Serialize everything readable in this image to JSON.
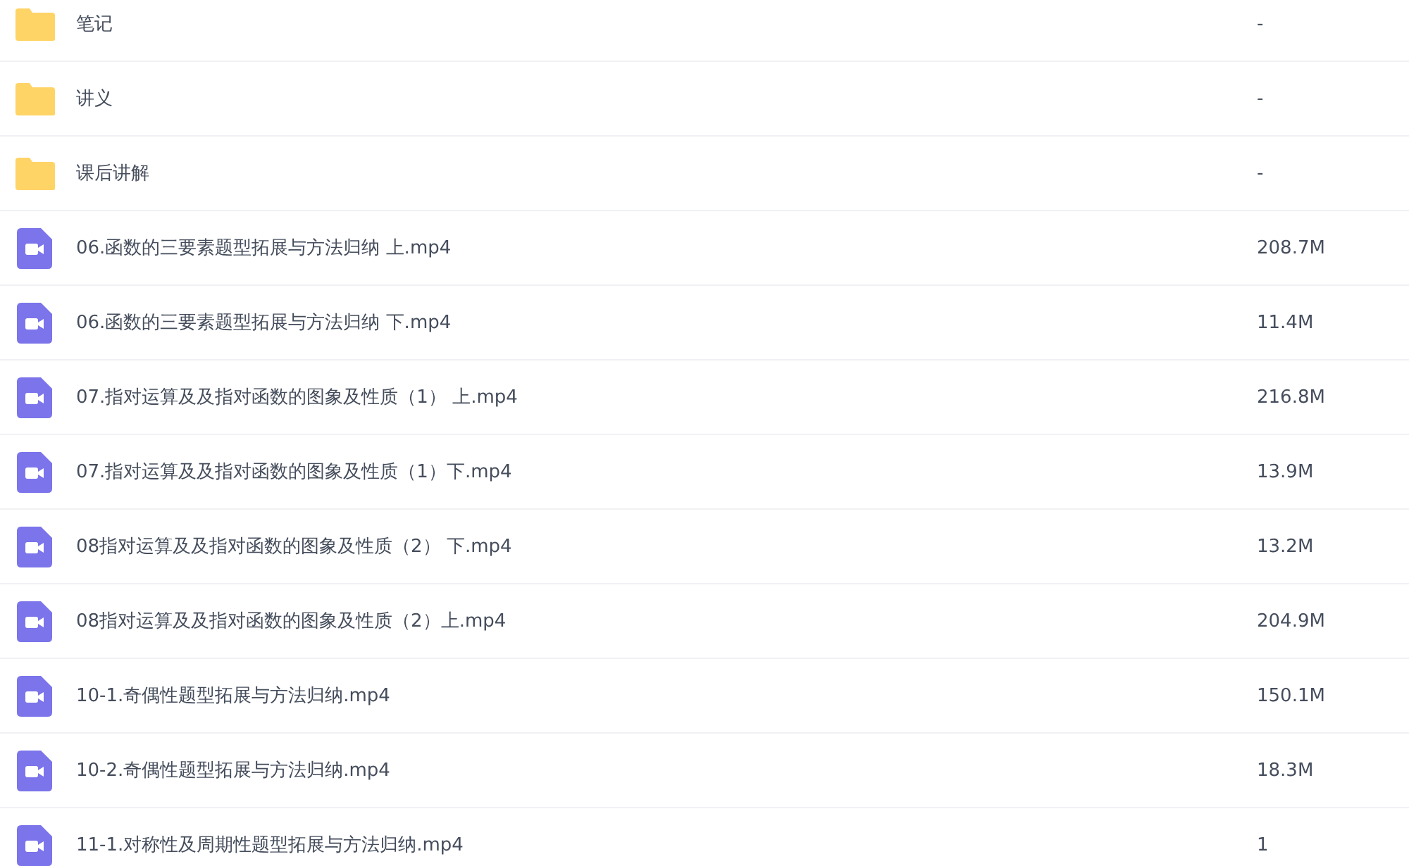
{
  "files": [
    {
      "kind": "folder",
      "name": "笔记",
      "size": "-"
    },
    {
      "kind": "folder",
      "name": "讲义",
      "size": "-"
    },
    {
      "kind": "folder",
      "name": "课后讲解",
      "size": "-"
    },
    {
      "kind": "video",
      "name": "06.函数的三要素题型拓展与方法归纳 上.mp4",
      "size": "208.7M"
    },
    {
      "kind": "video",
      "name": "06.函数的三要素题型拓展与方法归纳 下.mp4",
      "size": "11.4M"
    },
    {
      "kind": "video",
      "name": "07.指对运算及及指对函数的图象及性质（1） 上.mp4",
      "size": "216.8M"
    },
    {
      "kind": "video",
      "name": "07.指对运算及及指对函数的图象及性质（1）下.mp4",
      "size": "13.9M"
    },
    {
      "kind": "video",
      "name": "08指对运算及及指对函数的图象及性质（2） 下.mp4",
      "size": "13.2M"
    },
    {
      "kind": "video",
      "name": "08指对运算及及指对函数的图象及性质（2）上.mp4",
      "size": "204.9M"
    },
    {
      "kind": "video",
      "name": "10-1.奇偶性题型拓展与方法归纳.mp4",
      "size": "150.1M"
    },
    {
      "kind": "video",
      "name": "10-2.奇偶性题型拓展与方法归纳.mp4",
      "size": "18.3M"
    },
    {
      "kind": "video",
      "name": "11-1.对称性及周期性题型拓展与方法归纳.mp4",
      "size": "1"
    }
  ]
}
